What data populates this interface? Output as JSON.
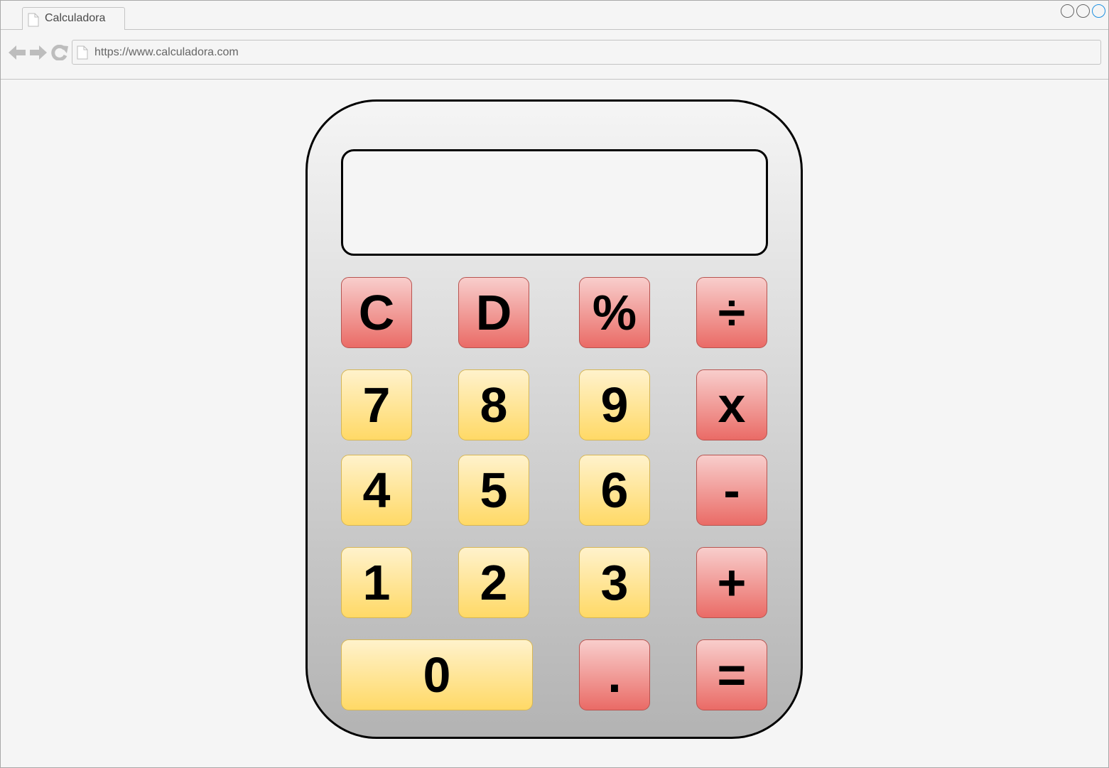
{
  "browser": {
    "tab_title": "Calculadora",
    "url": "https://www.calculadora.com"
  },
  "calculator": {
    "display": "",
    "keys": {
      "clear": "C",
      "delete": "D",
      "percent": "%",
      "divide": "÷",
      "seven": "7",
      "eight": "8",
      "nine": "9",
      "multiply": "x",
      "four": "4",
      "five": "5",
      "six": "6",
      "subtract": "-",
      "one": "1",
      "two": "2",
      "three": "3",
      "add": "+",
      "zero": "0",
      "decimal": ".",
      "equals": "="
    }
  },
  "colors": {
    "operator_key": "#ea6b66",
    "digit_key": "#ffd966",
    "close_control": "#1e90e0"
  }
}
